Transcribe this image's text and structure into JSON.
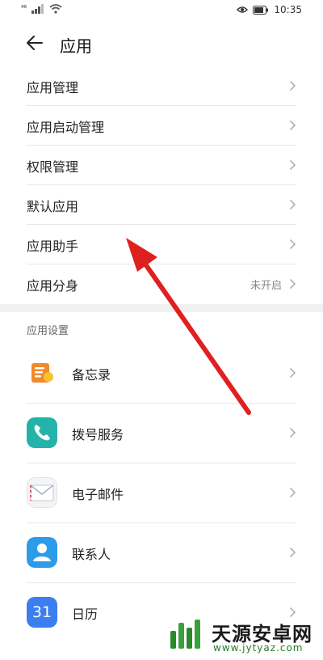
{
  "status_bar": {
    "time": "10:35",
    "signal_label": "⁴⁶"
  },
  "header": {
    "title": "应用"
  },
  "menu": [
    {
      "label": "应用管理",
      "value": ""
    },
    {
      "label": "应用启动管理",
      "value": ""
    },
    {
      "label": "权限管理",
      "value": ""
    },
    {
      "label": "默认应用",
      "value": ""
    },
    {
      "label": "应用助手",
      "value": ""
    },
    {
      "label": "应用分身",
      "value": "未开启"
    }
  ],
  "section_title": "应用设置",
  "apps": [
    {
      "label": "备忘录",
      "icon": "memo-icon",
      "color": "#f08a2a"
    },
    {
      "label": "拨号服务",
      "icon": "phone-icon",
      "color": "#23b3a8"
    },
    {
      "label": "电子邮件",
      "icon": "email-icon",
      "color": "#f3f3f3"
    },
    {
      "label": "联系人",
      "icon": "contacts-icon",
      "color": "#2c9be8"
    },
    {
      "label": "日历",
      "icon": "calendar-icon",
      "color": "#3a7ef0",
      "badge": "31"
    }
  ],
  "annotation": {
    "color": "#e02020"
  },
  "watermark": {
    "title": "天源安卓网",
    "url": "www.jytyaz.com"
  }
}
